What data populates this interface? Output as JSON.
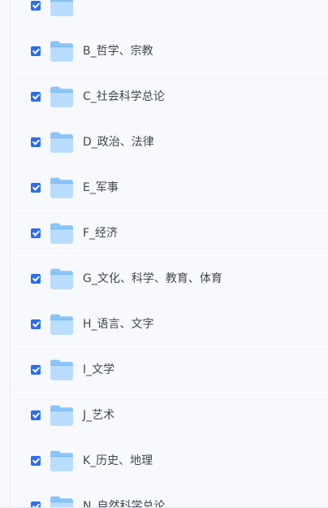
{
  "folders": [
    {
      "name": "",
      "checked": true,
      "icon": "folder-icon"
    },
    {
      "name": "B_哲学、宗教",
      "checked": true,
      "icon": "folder-icon"
    },
    {
      "name": "C_社会科学总论",
      "checked": true,
      "icon": "folder-icon"
    },
    {
      "name": "D_政治、法律",
      "checked": true,
      "icon": "folder-icon"
    },
    {
      "name": "E_军事",
      "checked": true,
      "icon": "folder-icon"
    },
    {
      "name": "F_经济",
      "checked": true,
      "icon": "folder-icon"
    },
    {
      "name": "G_文化、科学、教育、体育",
      "checked": true,
      "icon": "folder-icon"
    },
    {
      "name": "H_语言、文字",
      "checked": true,
      "icon": "folder-icon"
    },
    {
      "name": "I_文学",
      "checked": true,
      "icon": "folder-icon"
    },
    {
      "name": "J_艺术",
      "checked": true,
      "icon": "folder-icon"
    },
    {
      "name": "K_历史、地理",
      "checked": true,
      "icon": "folder-icon"
    },
    {
      "name": "N_自然科学总论",
      "checked": true,
      "icon": "folder-icon"
    }
  ],
  "colors": {
    "checkbox": "#2c6df0",
    "row_background": "#f8f9fd",
    "text": "#3f4750",
    "folder_light": "#b9ddff",
    "folder_dark": "#75baf7"
  }
}
